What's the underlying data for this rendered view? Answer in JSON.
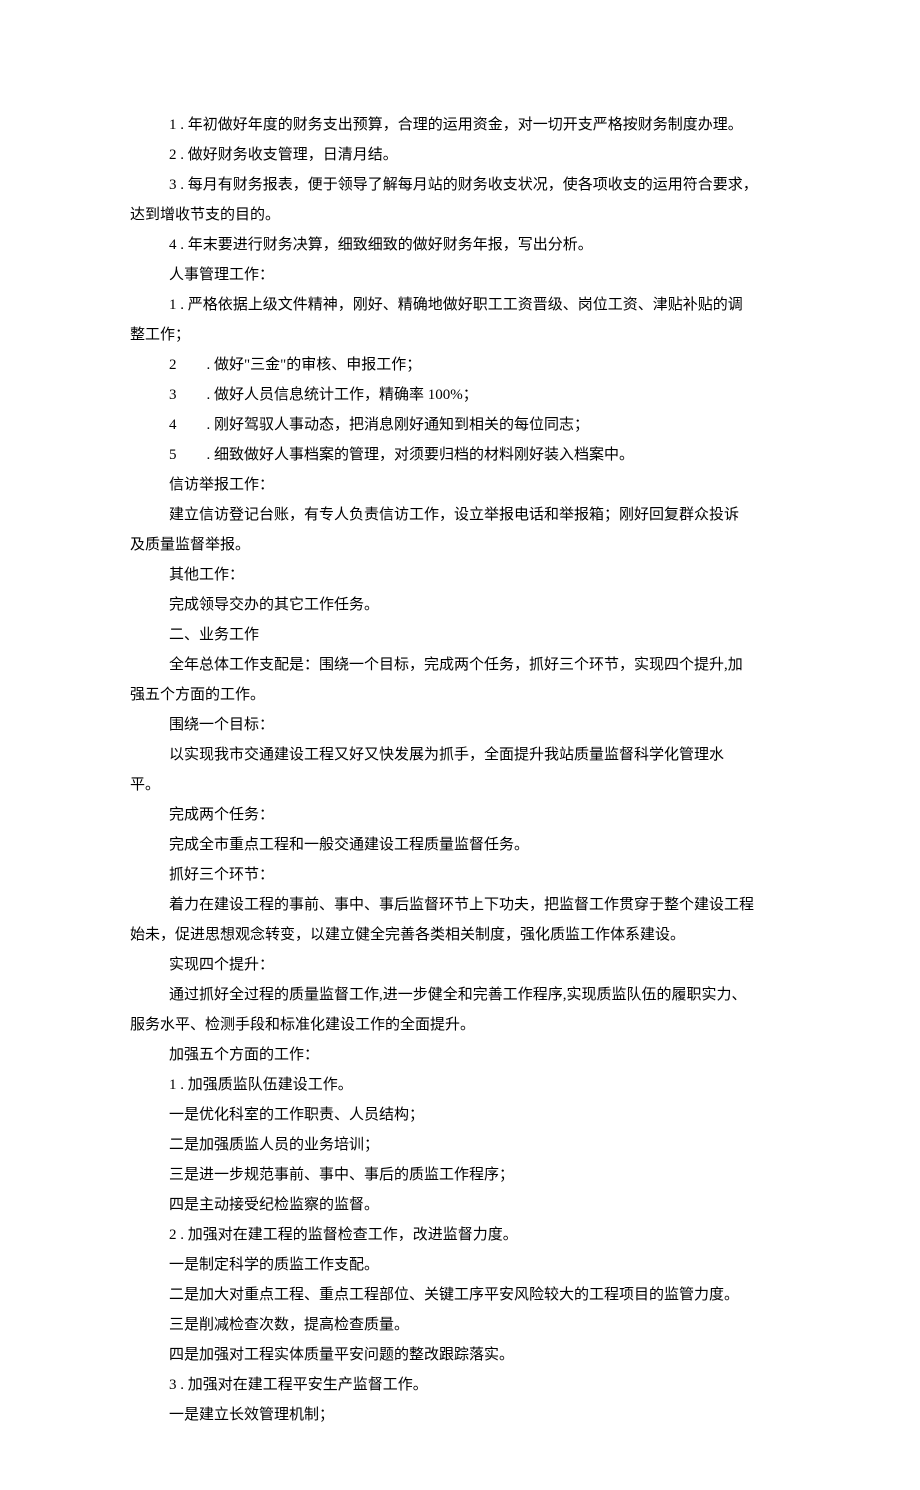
{
  "lines": {
    "l01": "1 . 年初做好年度的财务支出预算，合理的运用资金，对一切开支严格按财务制度办理。",
    "l02": "2 . 做好财务收支管理，日清月结。",
    "l03": "3 . 每月有财务报表，便于领导了解每月站的财务收支状况，使各项收支的运用符合要求，",
    "l03b": "达到增收节支的目的。",
    "l04": "4 . 年末要进行财务决算，细致细致的做好财务年报，写出分析。",
    "heading_renshi": "人事管理工作：",
    "l05": "1 . 严格依据上级文件精神，刚好、精确地做好职工工资晋级、岗位工资、津贴补贴的调",
    "l05b": "整工作；",
    "l06_num": "2",
    "l06_txt": ". 做好\"三金\"的审核、申报工作；",
    "l07_num": "3",
    "l07_txt": ". 做好人员信息统计工作，精确率 100%；",
    "l08_num": "4",
    "l08_txt": ". 刚好驾驭人事动态，把消息刚好通知到相关的每位同志；",
    "l09_num": "5",
    "l09_txt": ". 细致做好人事档案的管理，对须要归档的材料刚好装入档案中。",
    "heading_xinfang": "信访举报工作：",
    "l10": "建立信访登记台账，有专人负责信访工作，设立举报电话和举报箱；刚好回复群众投诉",
    "l10b": "及质量监督举报。",
    "heading_qita": "其他工作：",
    "l11": "完成领导交办的其它工作任务。",
    "heading_er": "二、业务工作",
    "l12": "全年总体工作支配是：围绕一个目标，完成两个任务，抓好三个环节，实现四个提升,加",
    "l12b": "强五个方面的工作。",
    "heading_weirao": "围绕一个目标：",
    "l13": "以实现我市交通建设工程又好又快发展为抓手，全面提升我站质量监督科学化管理水",
    "l13b": "平。",
    "heading_wancheng": "完成两个任务：",
    "l14": "完成全市重点工程和一般交通建设工程质量监督任务。",
    "heading_zhuahao": "抓好三个环节：",
    "l15": "着力在建设工程的事前、事中、事后监督环节上下功夫，把监督工作贯穿于整个建设工程",
    "l15b": "始未，促进思想观念转变，以建立健全完善各类相关制度，强化质监工作体系建设。",
    "heading_shixian": "实现四个提升：",
    "l16": "通过抓好全过程的质量监督工作,进一步健全和完善工作程序,实现质监队伍的履职实力、",
    "l16b": "服务水平、检测手段和标准化建设工作的全面提升。",
    "heading_jiaqiang": "加强五个方面的工作：",
    "l17": "1 . 加强质监队伍建设工作。",
    "l18": "一是优化科室的工作职责、人员结构；",
    "l19": "二是加强质监人员的业务培训；",
    "l20": "三是进一步规范事前、事中、事后的质监工作程序；",
    "l21": "四是主动接受纪检监察的监督。",
    "l22": "2 . 加强对在建工程的监督检查工作，改进监督力度。",
    "l23": "一是制定科学的质监工作支配。",
    "l24": "二是加大对重点工程、重点工程部位、关键工序平安风险较大的工程项目的监管力度。",
    "l25": "三是削减检查次数，提高检查质量。",
    "l26": "四是加强对工程实体质量平安问题的整改跟踪落实。",
    "l27": "3 . 加强对在建工程平安生产监督工作。",
    "l28": "一是建立长效管理机制；"
  }
}
